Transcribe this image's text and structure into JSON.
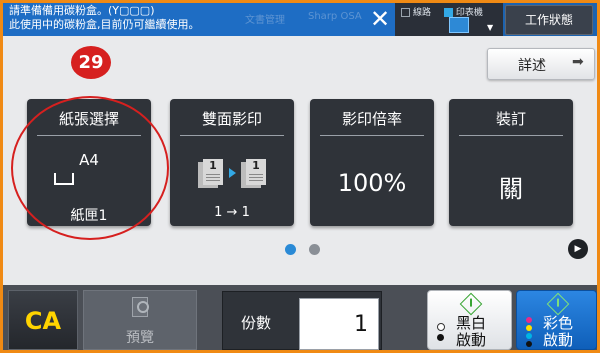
{
  "notification": {
    "line1": "請準備備用碳粉盒。(Y▢▢▢)",
    "line2": "此使用中的碳粉盒,目前仍可繼續使用。",
    "close_glyph": "✕",
    "ghost_text_1": "文書管理",
    "ghost_text_2": "Sharp OSA"
  },
  "status": {
    "line_label": "線路",
    "printer_label": "印表機",
    "job_status_label": "工作狀態"
  },
  "detail_button": {
    "label": "詳述",
    "arrow": "➡"
  },
  "callout_number": "29",
  "tiles": [
    {
      "title": "紙張選擇",
      "value": "A4",
      "sub": "紙匣1"
    },
    {
      "title": "雙面影印",
      "left_page": "1",
      "right_page": "1",
      "sub": "1 → 1"
    },
    {
      "title": "影印倍率",
      "value": "100%"
    },
    {
      "title": "裝訂",
      "value": "關"
    }
  ],
  "pager": {
    "current": 1,
    "total": 2,
    "next_glyph": "▶"
  },
  "bottom": {
    "ca_label": "CA",
    "preview_label": "預覽",
    "copies_label": "份數",
    "copies_value": "1",
    "bw_start_line1": "黑白",
    "bw_start_line2": "啟動",
    "color_start_line1": "彩色",
    "color_start_line2": "啟動"
  },
  "colors": {
    "accent_blue": "#1e6dc4",
    "highlight_orange": "#f08a14",
    "callout_red": "#d6201f",
    "ca_yellow": "#ffd400"
  }
}
